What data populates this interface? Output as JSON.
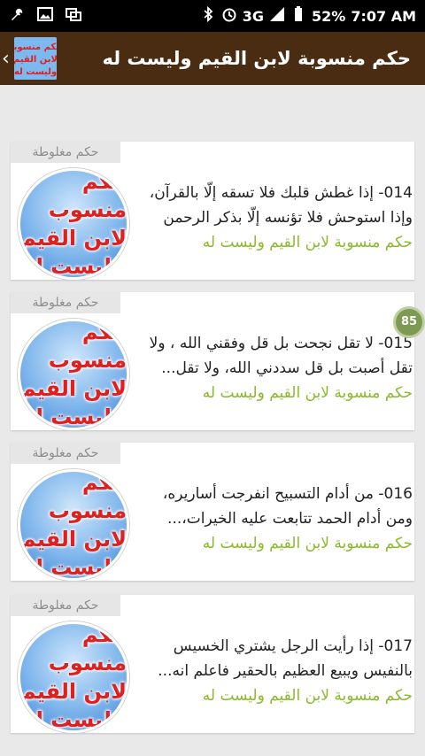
{
  "status_bar": {
    "network": "3G",
    "battery": "52%",
    "time": "7:07 AM"
  },
  "app_bar": {
    "title": "حكم منسوبة لابن القيم وليست له",
    "logo_lines": [
      "حكم منسوبة",
      "لابن القيم",
      "وليست له"
    ]
  },
  "badge": "85",
  "items": [
    {
      "tag": "حكم مغلوطة",
      "line1": "014- إذا غطش قلبك فلا تسقه إلّا بالقرآن،",
      "line2": "وإذا استوحش فلا تؤنسه إلّا بذكر الرحمن",
      "source": "حكم منسوبة لابن القيم وليست له",
      "thumb": [
        "حكم منسوب",
        "لابن القيم",
        "وليست له"
      ]
    },
    {
      "tag": "حكم مغلوطة",
      "line1": "015- لا تقل نجحت بل قل وفقني الله ، ولا",
      "line2": "تقل أصبت بل قل سددني الله، ولا تقل...",
      "source": "حكم منسوبة لابن القيم وليست له",
      "thumb": [
        "حكم منسوب",
        "لابن القيم",
        "وليست له"
      ]
    },
    {
      "tag": "حكم مغلوطة",
      "line1": "016- من أدام التسبيح انفرجت أساريره،",
      "line2": "ومن أدام الحمد تتابعت عليه الخيرات،...",
      "source": "حكم منسوبة لابن القيم وليست له",
      "thumb": [
        "حكم منسوب",
        "لابن القيم",
        "وليست له"
      ]
    },
    {
      "tag": "حكم مغلوطة",
      "line1": "017- إذا رأيت الرجل يشتري الخسيس",
      "line2": "بالنفيس ويبيع العظيم بالحقير فاعلم انه...",
      "source": "حكم منسوبة لابن القيم وليست له",
      "thumb": [
        "حكم منسوب",
        "لابن القيم",
        "وليست له"
      ]
    }
  ]
}
